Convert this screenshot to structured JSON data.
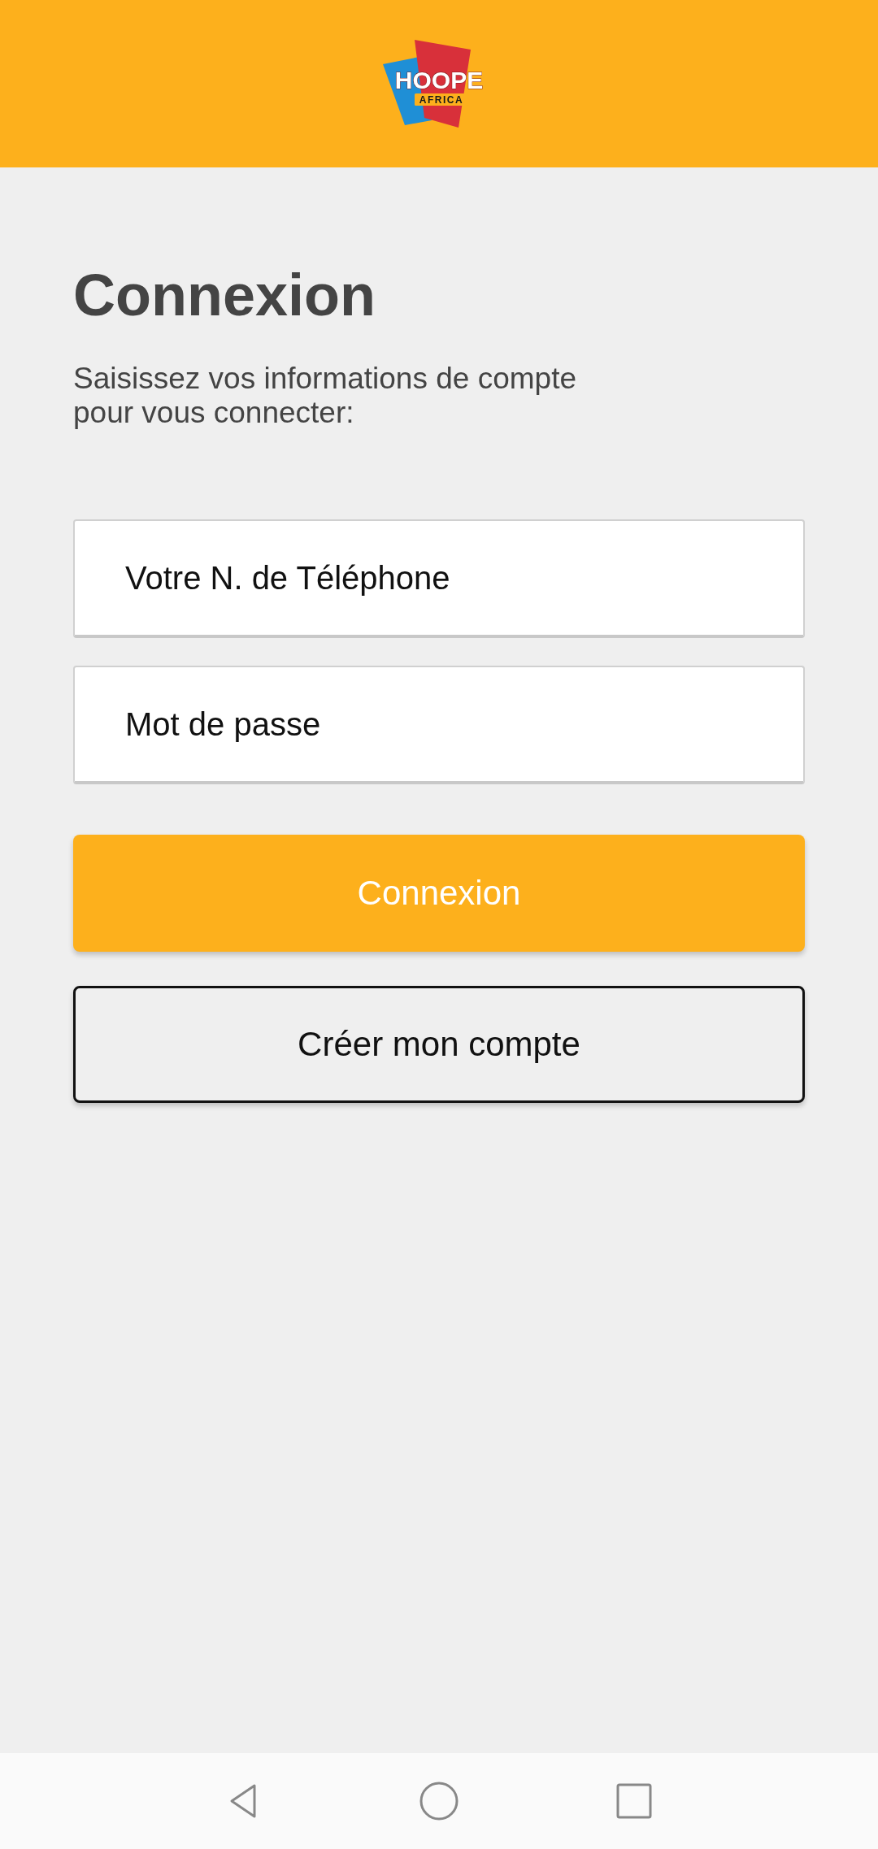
{
  "header": {
    "logo": {
      "name": "HOOPE",
      "tagline": "AFRICA"
    }
  },
  "title": "Connexion",
  "subtitle": "Saisissez vos informations de compte pour vous connecter:",
  "fields": [
    {
      "placeholder": "Votre N. de Téléphone"
    },
    {
      "placeholder": "Mot de passe"
    }
  ],
  "buttons": [
    {
      "label": "Connexion",
      "kind": "primary"
    },
    {
      "label": "Créer mon compte",
      "kind": "outline"
    }
  ]
}
